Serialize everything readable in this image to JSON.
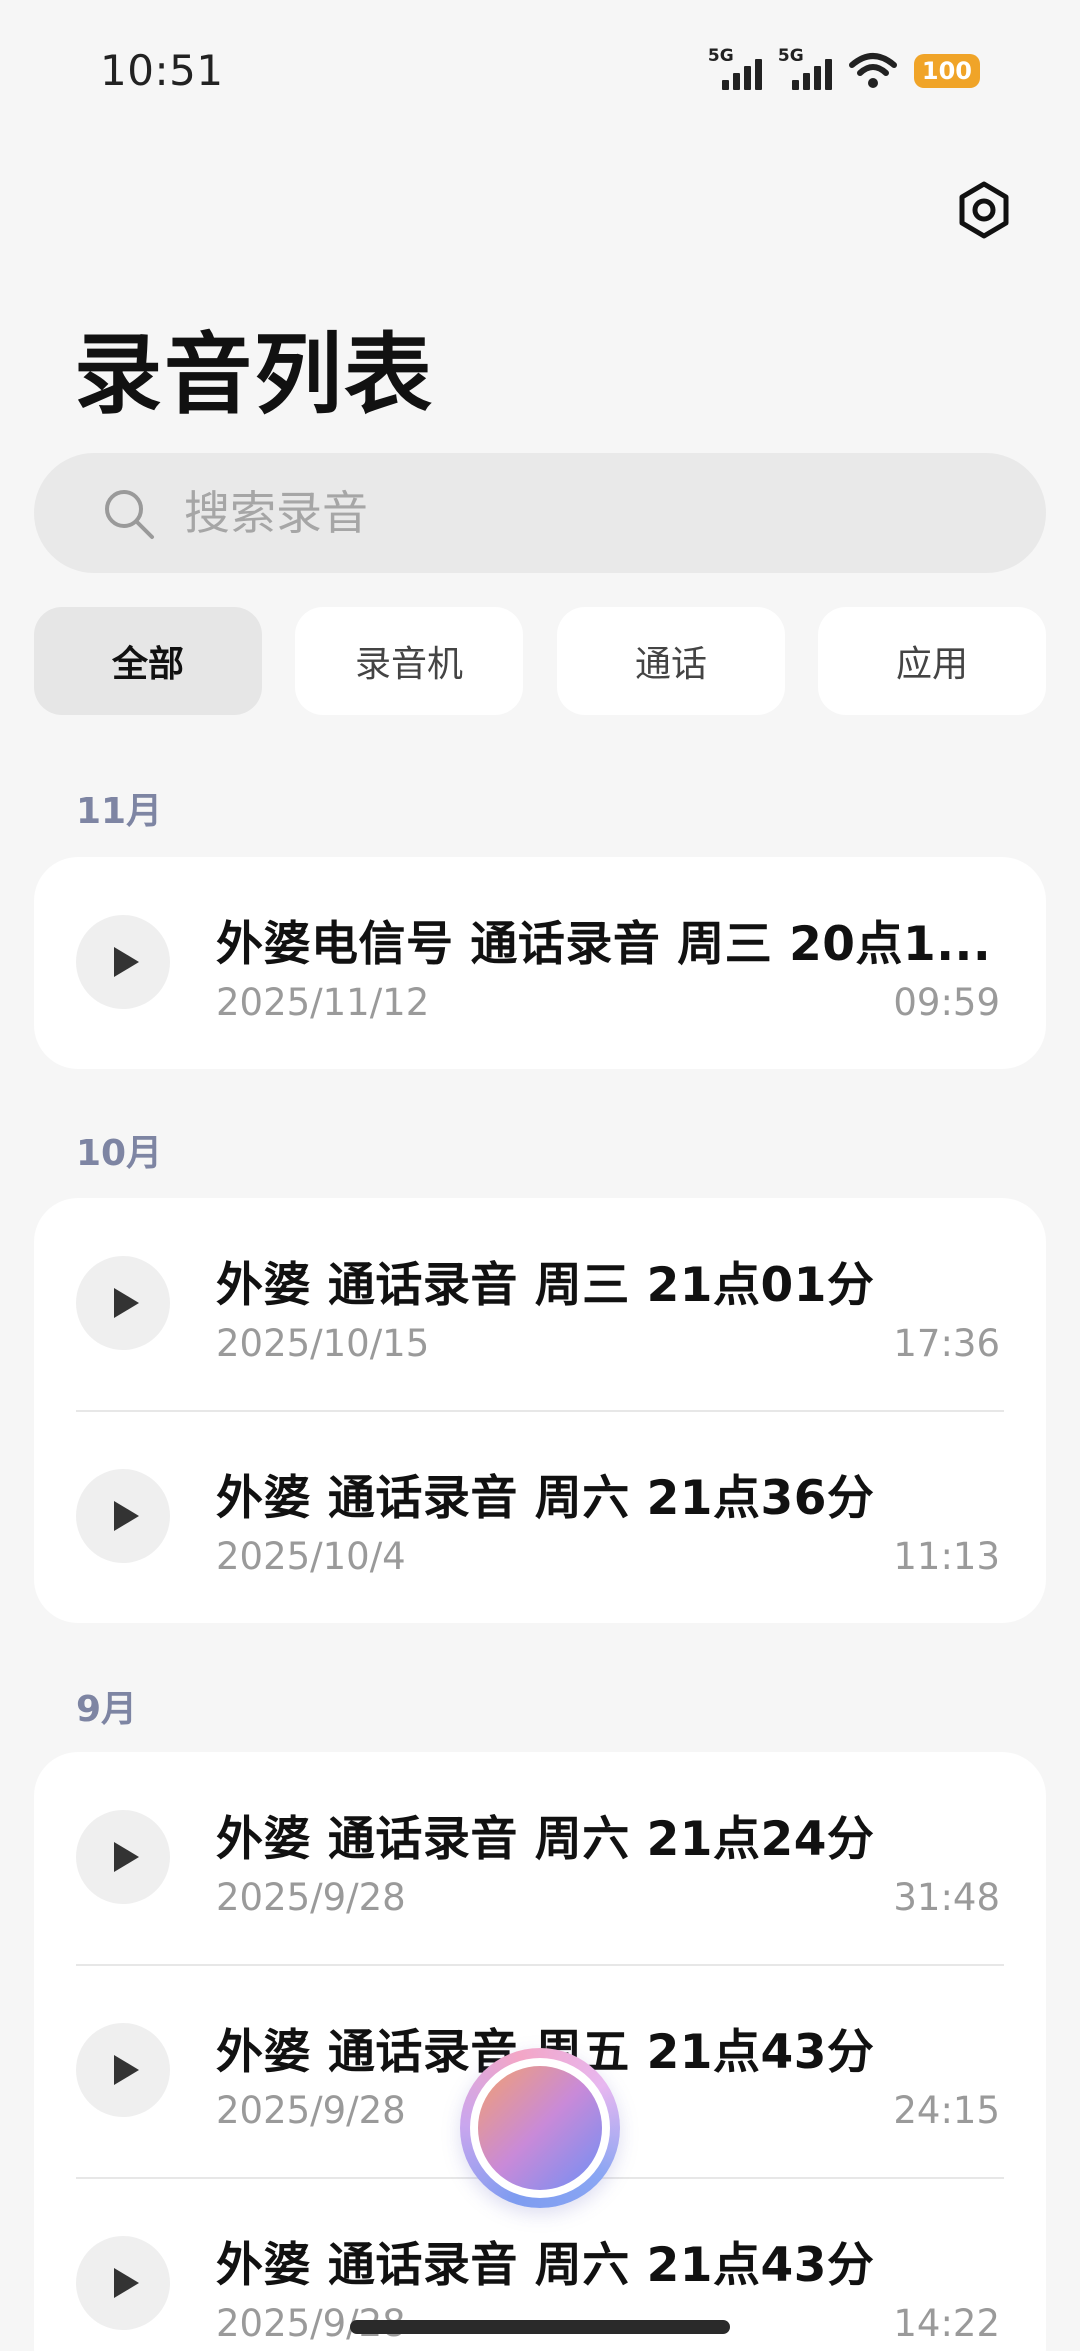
{
  "status_bar": {
    "time": "10:51",
    "signal_1": "5G",
    "signal_2": "5G",
    "battery": "100",
    "battery_color": "#f0a428"
  },
  "header": {
    "title": "录音列表",
    "settings_icon": "gear-icon"
  },
  "search": {
    "placeholder": "搜索录音",
    "icon": "search-icon"
  },
  "tabs": [
    {
      "label": "全部",
      "active": true
    },
    {
      "label": "录音机",
      "active": false
    },
    {
      "label": "通话",
      "active": false
    },
    {
      "label": "应用",
      "active": false
    }
  ],
  "sections": [
    {
      "month": "11月",
      "items": [
        {
          "title": "外婆电信号 通话录音 周三 20点1...",
          "date": "2025/11/12",
          "duration": "09:59"
        }
      ]
    },
    {
      "month": "10月",
      "items": [
        {
          "title": "外婆 通话录音 周三 21点01分",
          "date": "2025/10/15",
          "duration": "17:36"
        },
        {
          "title": "外婆 通话录音 周六 21点36分",
          "date": "2025/10/4",
          "duration": "11:13"
        }
      ]
    },
    {
      "month": "9月",
      "items": [
        {
          "title": "外婆 通话录音 周六 21点24分",
          "date": "2025/9/28",
          "duration": "31:48"
        },
        {
          "title": "外婆 通话录音 周五 21点43分",
          "date": "2025/9/28",
          "duration": "24:15"
        },
        {
          "title": "外婆 通话录音 周六 21点43分",
          "date": "2025/9/28",
          "duration": "14:22"
        }
      ]
    }
  ],
  "record_button_icon": "record-icon",
  "accent_colors": {
    "month_label": "#7e85a3",
    "secondary_text": "#9a9a9a"
  }
}
